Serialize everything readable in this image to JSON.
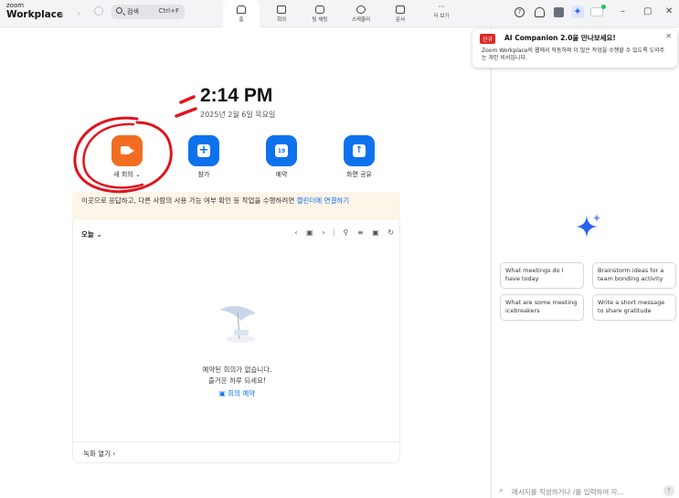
{
  "app": {
    "brand_small": "zoom",
    "brand_large": "Workplace"
  },
  "search": {
    "label": "검색",
    "shortcut": "Ctrl+F"
  },
  "nav": {
    "tabs": [
      {
        "label": "홈"
      },
      {
        "label": "회의"
      },
      {
        "label": "팀 채팅"
      },
      {
        "label": "스케줄러"
      },
      {
        "label": "문서"
      },
      {
        "label": "더 보기"
      }
    ]
  },
  "clock": {
    "time": "2:14 PM",
    "date": "2025년 2월 6일 목요일"
  },
  "actions": {
    "new_meeting": "새 회의",
    "join": "참가",
    "schedule": "예약",
    "share_screen": "화면 공유",
    "schedule_icon_text": "19"
  },
  "notice": {
    "text": "이곳으로 응답하고, 다른 사람의 사용 가능 여부 확인 등 작업을 수행하려면 ",
    "link": "캘린더에 연결하기"
  },
  "meetings": {
    "filter": "오늘",
    "empty_line1": "예약된 회의가 없습니다.",
    "empty_line2": "즐거운 하루 되세요!",
    "schedule_link": "회의 예약",
    "recordings": "녹화 열기"
  },
  "ai_banner": {
    "badge": "신규",
    "title": "AI Companion 2.0을 만나보세요!",
    "body": "Zoom Workplace의 웹에서 작동하며 더 많은 작업을 수행할 수 있도록 도와주는 개인 비서입니다."
  },
  "prompts": [
    "What meetings do I have today",
    "Brainstorm ideas for a team bonding activity",
    "What are some meeting icebreakers",
    "Write a short message to share gratitude"
  ],
  "composer": {
    "placeholder": "메시지를 작성하거나 /를 입력하여 자..."
  },
  "colors": {
    "accent_blue": "#0e72ed",
    "new_meeting_orange": "#f26d21",
    "annotation_red": "#e0151e",
    "badge_red": "#e02828"
  }
}
